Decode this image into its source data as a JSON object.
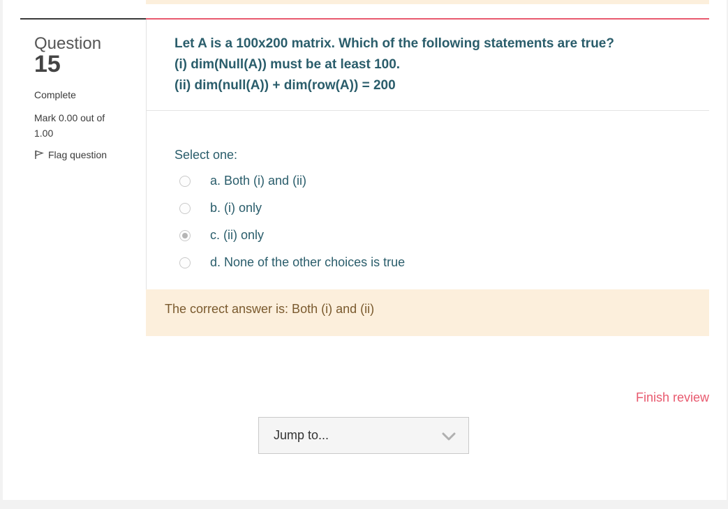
{
  "info": {
    "question_word": "Question",
    "question_number": "15",
    "state": "Complete",
    "grade": "Mark 0.00 out of 1.00",
    "flag_label": "Flag question"
  },
  "question": {
    "line1": "Let A is a 100x200 matrix. Which of the following statements are true?",
    "line2": "(i) dim(Null(A)) must be at least 100.",
    "line3": "(ii) dim(null(A)) + dim(row(A)) = 200"
  },
  "answer_prompt": "Select one:",
  "answers": [
    {
      "label": "a. Both (i) and (ii)",
      "selected": false
    },
    {
      "label": "b. (i) only",
      "selected": false
    },
    {
      "label": "c. (ii) only",
      "selected": true
    },
    {
      "label": "d. None of the other choices is true",
      "selected": false
    }
  ],
  "feedback": {
    "right_answer": "The correct answer is: Both (i) and (ii)"
  },
  "footer": {
    "finish_label": "Finish review",
    "jump_label": "Jump to..."
  },
  "colors": {
    "accent": "#e8596e",
    "question_text": "#2a5d6b",
    "feedback_bg": "#fcefdc"
  }
}
